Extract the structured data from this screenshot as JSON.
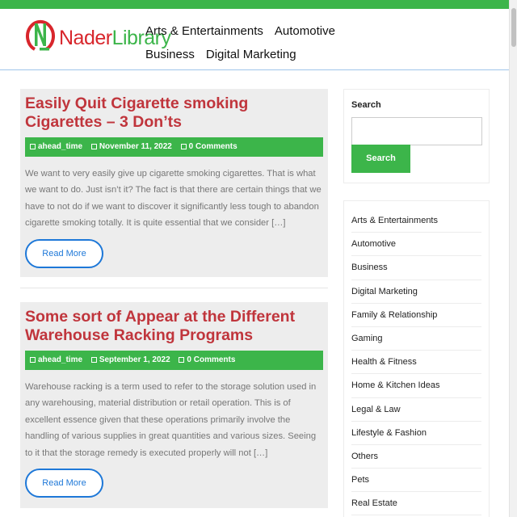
{
  "brand": {
    "word_part1": "Nader",
    "word_part2": "Library"
  },
  "colors": {
    "accent_green": "#3cb54a",
    "title_red": "#c0353c",
    "link_blue": "#1e78d8"
  },
  "nav": {
    "items": [
      "Arts & Entertainments",
      "Automotive",
      "Business",
      "Digital Marketing"
    ]
  },
  "posts": [
    {
      "title": "Easily Quit Cigarette smoking Cigarettes – 3 Don’ts",
      "author": "ahead_time",
      "date": "November 11, 2022",
      "comments": "0 Comments",
      "excerpt": "We want to very easily give up cigarette smoking cigarettes. That is what we want to do. Just isn’t it? The fact is that there are certain things that we have to not do if we want to discover it significantly less tough to abandon cigarette smoking totally. It is quite essential that we consider […]",
      "read_more": "Read More"
    },
    {
      "title": "Some sort of Appear at the Different Warehouse Racking Programs",
      "author": "ahead_time",
      "date": "September 1, 2022",
      "comments": "0 Comments",
      "excerpt": "Warehouse racking is a term used to refer to the storage solution used in any warehousing, material distribution or retail operation. This is of excellent essence given that these operations primarily involve the handling of various supplies in great quantities and various sizes. Seeing to it that the storage remedy is executed properly will not […]",
      "read_more": "Read More"
    }
  ],
  "sidebar": {
    "search": {
      "title": "Search",
      "placeholder": "",
      "button": "Search"
    },
    "categories": [
      "Arts & Entertainments",
      "Automotive",
      "Business",
      "Digital Marketing",
      "Family & Relationship",
      "Gaming",
      "Health & Fitness",
      "Home & Kitchen Ideas",
      "Legal & Law",
      "Lifestyle & Fashion",
      "Others",
      "Pets",
      "Real Estate"
    ]
  }
}
